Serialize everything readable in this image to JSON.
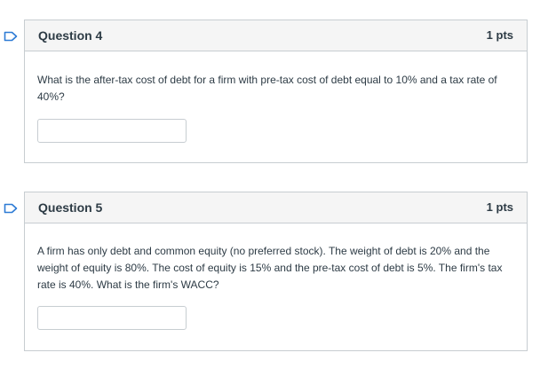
{
  "questions": [
    {
      "title": "Question 4",
      "points": "1 pts",
      "text": "What is the after-tax cost of debt for a firm with pre-tax cost of debt equal to 10% and a tax rate of 40%?",
      "answer_value": ""
    },
    {
      "title": "Question 5",
      "points": "1 pts",
      "text": "A firm has only debt and common equity (no preferred stock). The weight of debt is 20% and the weight of equity is 80%. The cost of equity is 15% and the pre-tax cost of debt is 5%. The firm's tax rate is 40%. What is the firm's WACC?",
      "answer_value": ""
    }
  ],
  "icons": {
    "flag": "flag-question-icon"
  },
  "colors": {
    "flag_stroke": "#2d7bd5",
    "border": "#c7cdd1",
    "header_bg": "#f5f5f5",
    "text": "#2d3b45"
  }
}
